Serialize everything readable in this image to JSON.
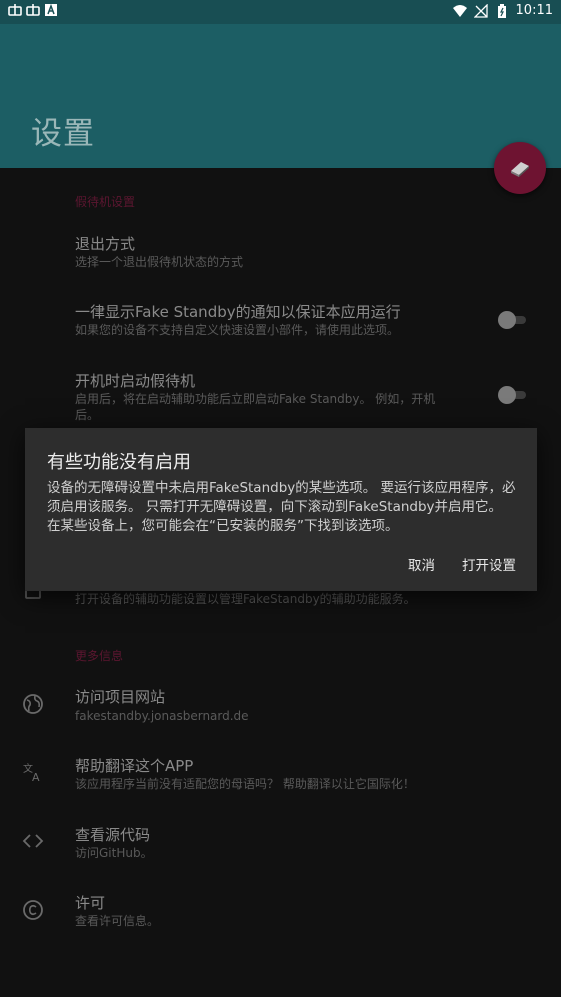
{
  "status_bar": {
    "time": "10:11"
  },
  "app_bar": {
    "title": "设置"
  },
  "fab": {
    "icon": "eraser-icon"
  },
  "settings": {
    "section1_header": "假待机设置",
    "exit_method": {
      "title": "退出方式",
      "subtitle": "选择一个退出假待机状态的方式"
    },
    "always_notification": {
      "title": "一律显示Fake Standby的通知以保证本应用运行",
      "subtitle": "如果您的设备不支持自定义快速设置小部件，请使用此选项。"
    },
    "start_on_boot": {
      "title": "开机时启动假待机",
      "subtitle_line1": "启用后，将在启动辅助功能后立即启动Fake Standby。 例如，开机",
      "subtitle_line2": "后。"
    },
    "accessibility": {
      "subtitle": "打开设备的辅助功能设置以管理FakeStandby的辅助功能服务。"
    },
    "section2_header": "更多信息",
    "website": {
      "title": "访问项目网站",
      "subtitle": "fakestandby.jonasbernard.de"
    },
    "translate": {
      "title": "帮助翻译这个APP",
      "subtitle": "该应用程序当前没有适配您的母语吗？ 帮助翻译以让它国际化！"
    },
    "source": {
      "title": "查看源代码",
      "subtitle": "访问GitHub。"
    },
    "license": {
      "title": "许可",
      "subtitle": "查看许可信息。"
    }
  },
  "dialog": {
    "title": "有些功能没有启用",
    "body": "设备的无障碍设置中未启用FakeStandby的某些选项。 要运行该应用程序，必须启用该服务。 只需打开无障碍设置，向下滚动到FakeStandby并启用它。 在某些设备上，您可能会在“已安装的服务”下找到该选项。",
    "cancel_label": "取消",
    "open_label": "打开设置"
  },
  "colors": {
    "appbar": "#1c5e64",
    "fab": "#6e1331",
    "accent": "#5c1630",
    "dialog": "#2d2d2d"
  }
}
